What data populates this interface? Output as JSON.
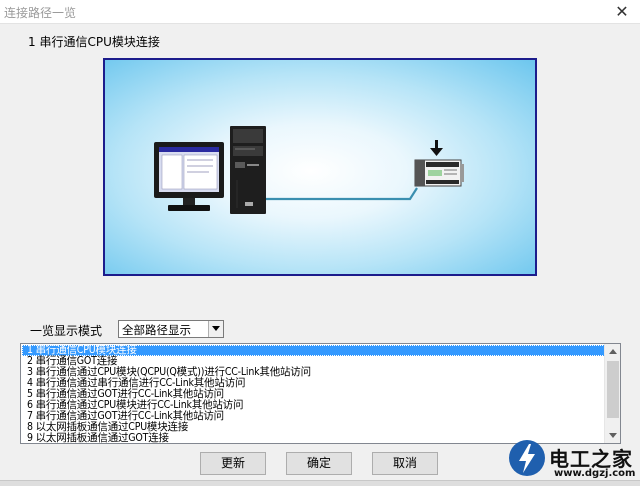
{
  "window": {
    "title": "连接路径一览"
  },
  "section": {
    "title": "1 串行通信CPU模块连接"
  },
  "mode": {
    "label": "一览显示模式",
    "selected": "全部路径显示"
  },
  "routes": [
    "1 串行通信CPU模块连接",
    "2 串行通信GOT连接",
    "3 串行通信通过CPU模块(QCPU(Q模式))进行CC-Link其他站访问",
    "4 串行通信通过串行通信进行CC-Link其他站访问",
    "5 串行通信通过GOT进行CC-Link其他站访问",
    "6 串行通信通过CPU模块进行CC-Link其他站访问",
    "7 串行通信通过GOT进行CC-Link其他站访问",
    "8 以太网插板通信通过CPU模块连接",
    "9 以太网插板通信通过GOT连接"
  ],
  "selected_route_index": 0,
  "buttons": {
    "refresh": "更新",
    "ok": "确定",
    "cancel": "取消"
  },
  "watermark": {
    "text": "电工之家",
    "url": "www.dgzj.com"
  },
  "colors": {
    "selection": "#3399ff",
    "diagram_border": "#1c1c8c",
    "cable": "#3a8fb0"
  }
}
